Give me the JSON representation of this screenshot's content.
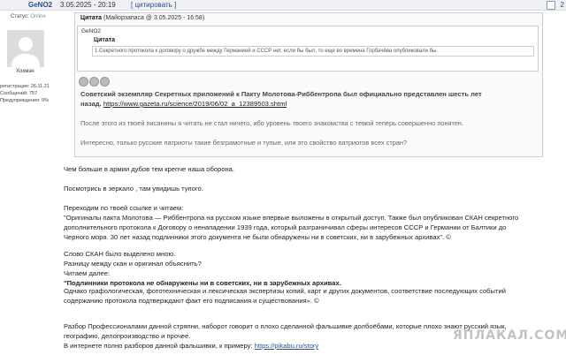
{
  "header": {
    "author": "GeNO2",
    "date": "3.05.2025 - 20:19",
    "quote_link": "[ цитировать ]",
    "post_number": "2"
  },
  "sidebar": {
    "status_label": "Статус:",
    "status_value": "Online",
    "rank": "Хохмач",
    "registration": "регистрация: 26.11.21",
    "messages": "Сообщений: 757",
    "warnings": "Предупреждения: 0%"
  },
  "quote": {
    "header_title": "Цитата",
    "header_meta": "(Майорзапаса @ 3.05.2025 - 16:58)",
    "nested_author": "GeNO2",
    "nested_title": "Цитата",
    "nested_text": "1.Секретного протокола к договору о дружбе между Германией и СССР нет, если бы был, то еще во времена Горбачёва опубликовали бы.",
    "p1_bold": "Советский экземпляр Секретных приложений к Пакту Молотова-Риббентропа был официально представлен шесть лет назад.",
    "p1_link": "https://www.gazeta.ru/science/2019/06/02_a_12389503.shtml",
    "p2": "После этого из твоей писанины я читать не стал ничего, ибо уровень твоего знакомства с темой теперь совершенно понятен.",
    "p3": "Интересно, только русские патриоты такие безграмотные и тупые, или это свойство патриотов всех стран?"
  },
  "body": {
    "p1": "Чем больше в армии дубов тем крепче наша оборона.",
    "p2": "Посмотрись в зеркало , там увидишь тупого.",
    "p3_intro": "Переходим по твоей ссылке и читаем:",
    "p3_quote": "\"Оригиналы пакта Молотова — Риббентропа на русском языке впервые выложены в открытый доступ. Также был опубликован СКАН секретного дополнительного протокола к Договору о ненападении 1939 года, который разграничивал сферы интересов СССР и Германии от Балтики до Черного моря. 30 лет назад подлинники этого документа не были обнаружены ни в советских, ни в зарубежных архивах\". ©",
    "p4_line1": "Слово СКАН было выделено мною.",
    "p4_line2": "Разницу между скан и оригинал объяснить?",
    "p4_line3": "Читаем далее:",
    "p4_bold": "\"Подлинники протокола не обнаружены ни в советских, ни в зарубежных архивах.",
    "p5": "Однако графологическая, фототехническая и лексическая экспертизы копий, карт и других документов, соответствие последующих событий содержанию протокола подтверждают факт его подписания и существования». ©",
    "p6_line1": "Разбор Профессионалами данной стряпни, наборот говорит о плохо сделанной фальшивке долбоёбами, которые плохо знают русский язык, географию, делопроизводство и прочее.",
    "p6_line2": "В интернете полно разборов данной фальшивки, к примеру:",
    "p6_link": "https://pikabu.ru/story"
  },
  "watermark": "ЯПЛАКАЛ.COM"
}
